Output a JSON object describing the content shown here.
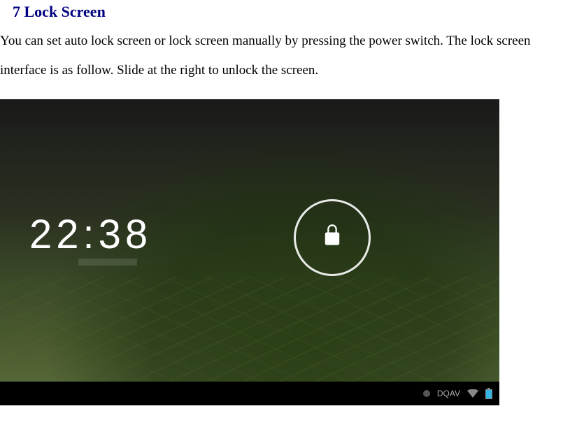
{
  "doc": {
    "heading": "7 Lock Screen",
    "paragraph": "You can set auto lock screen or lock screen manually by pressing the power switch. The lock screen interface is as follow. Slide at the right to unlock the screen."
  },
  "lockscreen": {
    "clock_time": "22:38",
    "brand_text": "DQAV"
  }
}
